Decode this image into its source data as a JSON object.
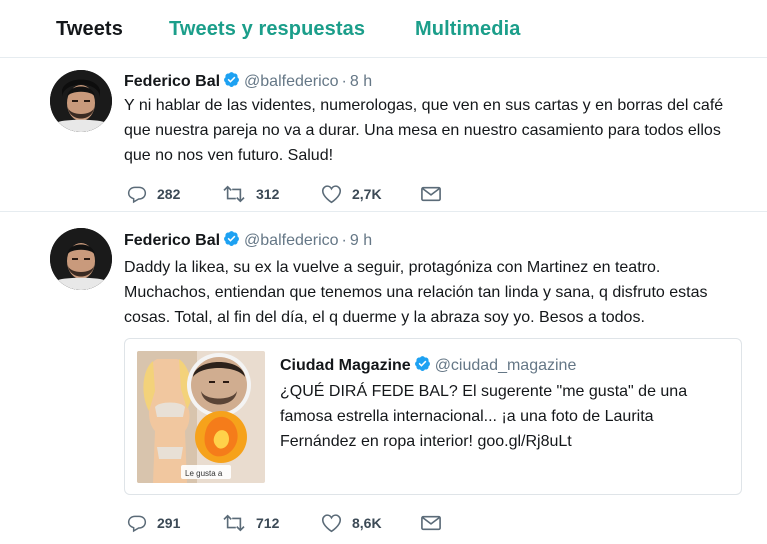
{
  "tabs": [
    {
      "label": "Tweets"
    },
    {
      "label": "Tweets y respuestas"
    },
    {
      "label": "Multimedia"
    }
  ],
  "colors": {
    "accent": "#1b9e8a",
    "verified": "#1da1f2",
    "muted": "#657786"
  },
  "tweets": [
    {
      "name": "Federico Bal",
      "handle": "@balfederico",
      "time": "8 h",
      "text": "Y ni hablar de las videntes, numerologas, que ven en sus cartas y en borras del café que nuestra pareja no va a durar. Una mesa en nuestro casamiento para todos ellos que no nos ven futuro. Salud!",
      "replies": "282",
      "retweets": "312",
      "likes": "2,7K"
    },
    {
      "name": "Federico Bal",
      "handle": "@balfederico",
      "time": "9 h",
      "text": "Daddy la likea, su ex la vuelve a seguir, protagóniza con Martinez en teatro. Muchachos, entiendan que tenemos una relación tan linda y sana, q disfruto estas cosas. Total, al fin del día, el q duerme y la abraza soy yo. Besos a todos.",
      "quote": {
        "name": "Ciudad Magazine",
        "handle": "@ciudad_magazine",
        "text": "¿QUÉ DIRÁ FEDE BAL? El sugerente \"me gusta\" de una famosa estrella internacional... ¡a una foto de Laurita Fernández en ropa interior! goo.gl/Rj8uLt",
        "image_caption": "Le gusta a"
      },
      "replies": "291",
      "retweets": "712",
      "likes": "8,6K"
    }
  ],
  "icons": {
    "verified": "verified-badge-icon",
    "reply": "reply-icon",
    "retweet": "retweet-icon",
    "like": "heart-icon",
    "dm": "envelope-icon"
  }
}
